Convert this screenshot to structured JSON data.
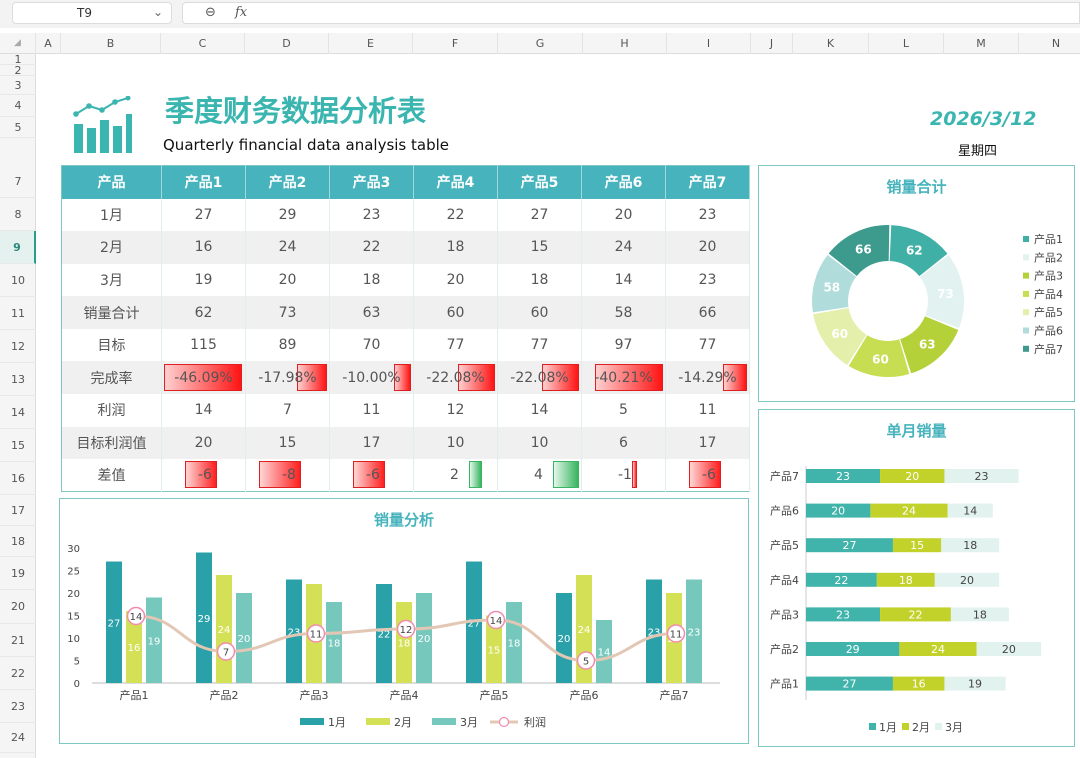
{
  "name_box": {
    "value": "T9",
    "chevron": "⌄"
  },
  "formula_bar": {
    "zoom_icon": "⊖",
    "fx_label": "fx"
  },
  "columns": [
    "A",
    "B",
    "C",
    "D",
    "E",
    "F",
    "G",
    "H",
    "I",
    "J",
    "K",
    "L",
    "M",
    "N"
  ],
  "rows": [
    "1",
    "2",
    "3",
    "4",
    "5",
    "7",
    "8",
    "9",
    "10",
    "11",
    "12",
    "13",
    "14",
    "15",
    "16",
    "17",
    "18",
    "19",
    "20",
    "21",
    "22",
    "23",
    "24"
  ],
  "selected_row": "9",
  "header": {
    "title": "季度财务数据分析表",
    "subtitle": "Quarterly financial data analysis table",
    "date": "2026/3/12",
    "weekday": "星期四"
  },
  "table": {
    "headers": [
      "产品",
      "产品1",
      "产品2",
      "产品3",
      "产品4",
      "产品5",
      "产品6",
      "产品7"
    ],
    "rows": [
      {
        "label": "1月",
        "values": [
          "27",
          "29",
          "23",
          "22",
          "27",
          "20",
          "23"
        ]
      },
      {
        "label": "2月",
        "values": [
          "16",
          "24",
          "22",
          "18",
          "15",
          "24",
          "20"
        ]
      },
      {
        "label": "3月",
        "values": [
          "19",
          "20",
          "18",
          "20",
          "18",
          "14",
          "23"
        ]
      },
      {
        "label": "销量合计",
        "values": [
          "62",
          "73",
          "63",
          "60",
          "60",
          "58",
          "66"
        ]
      },
      {
        "label": "目标",
        "values": [
          "115",
          "89",
          "70",
          "77",
          "77",
          "97",
          "77"
        ]
      },
      {
        "label": "完成率",
        "values": [
          "-46.09%",
          "-17.98%",
          "-10.00%",
          "-22.08%",
          "-22.08%",
          "-40.21%",
          "-14.29%"
        ],
        "bars": [
          -0.4609,
          -0.1798,
          -0.1,
          -0.2208,
          -0.2208,
          -0.4021,
          -0.1429
        ]
      },
      {
        "label": "利润",
        "values": [
          "14",
          "7",
          "11",
          "12",
          "14",
          "5",
          "11"
        ]
      },
      {
        "label": "目标利润值",
        "values": [
          "20",
          "15",
          "17",
          "10",
          "10",
          "6",
          "17"
        ]
      },
      {
        "label": "差值",
        "values": [
          "-6",
          "-8",
          "-6",
          "2",
          "4",
          "-1",
          "-6"
        ],
        "bars": [
          -6,
          -8,
          -6,
          2,
          4,
          -1,
          -6
        ]
      }
    ]
  },
  "colors": {
    "m1": "#2aa1a8",
    "m2": "#d4e157",
    "m3": "#76c8bd",
    "profit": "#e2c7b5",
    "marker": "#f08cb0"
  },
  "chart_data": [
    {
      "type": "pie",
      "title": "销量合计",
      "labels": [
        "产品1",
        "产品2",
        "产品3",
        "产品4",
        "产品5",
        "产品6",
        "产品7"
      ],
      "values": [
        62,
        73,
        63,
        60,
        60,
        58,
        66
      ],
      "colors": [
        "#40b0a6",
        "#e1f2f0",
        "#b5d13a",
        "#c7dd52",
        "#e3efaa",
        "#b0dddb",
        "#3c9b8d"
      ],
      "legend": "right"
    },
    {
      "type": "bar",
      "title": "单月销量",
      "orientation": "horizontal",
      "stacked": true,
      "categories": [
        "产品7",
        "产品6",
        "产品5",
        "产品4",
        "产品3",
        "产品2",
        "产品1"
      ],
      "series": [
        {
          "name": "1月",
          "values": [
            23,
            20,
            27,
            22,
            23,
            29,
            27
          ]
        },
        {
          "name": "2月",
          "values": [
            20,
            24,
            15,
            18,
            22,
            24,
            16
          ]
        },
        {
          "name": "3月",
          "values": [
            23,
            14,
            18,
            20,
            18,
            20,
            19
          ]
        }
      ],
      "colors": [
        "#40b3aa",
        "#c2d22b",
        "#e2f2ef"
      ],
      "legend": "bottom"
    },
    {
      "type": "bar",
      "title": "销量分析",
      "categories": [
        "产品1",
        "产品2",
        "产品3",
        "产品4",
        "产品5",
        "产品6",
        "产品7"
      ],
      "series": [
        {
          "name": "1月",
          "values": [
            27,
            29,
            23,
            22,
            27,
            20,
            23
          ]
        },
        {
          "name": "2月",
          "values": [
            16,
            24,
            22,
            18,
            15,
            24,
            20
          ]
        },
        {
          "name": "3月",
          "values": [
            19,
            20,
            18,
            20,
            18,
            14,
            23
          ]
        },
        {
          "name": "利润",
          "type": "line",
          "values": [
            14,
            7,
            11,
            12,
            14,
            5,
            11
          ]
        }
      ],
      "ylim": [
        0,
        30
      ],
      "yticks": [
        "30",
        "25",
        "20",
        "15",
        "10",
        "5",
        "0"
      ],
      "legend": "bottom"
    }
  ]
}
